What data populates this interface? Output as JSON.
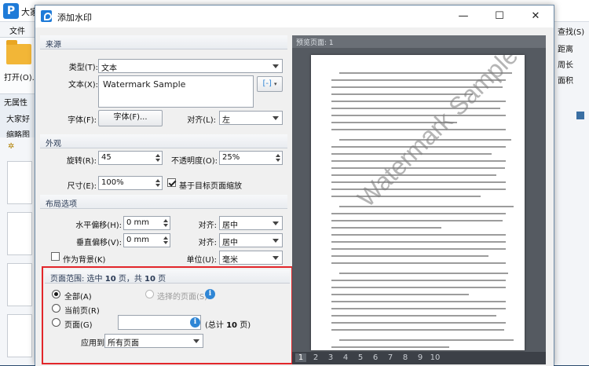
{
  "bg": {
    "app_title": "大家",
    "menu_file": "文件",
    "open_label": "打开(O)...",
    "no_props": "无属性",
    "doc_tab": "大家好",
    "thumbs_tab": "缩略图",
    "right_items": [
      "查找(S)",
      "距离",
      "周长",
      "面积"
    ]
  },
  "dialog": {
    "title": "添加水印",
    "source": {
      "header": "来源",
      "type_label": "类型(T):",
      "type_value": "文本",
      "text_label": "文本(X):",
      "text_value": "Watermark Sample",
      "font_label": "字体(F):",
      "font_button": "字体(F)...",
      "align_label": "对齐(L):",
      "align_value": "左"
    },
    "appearance": {
      "header": "外观",
      "rotation_label": "旋转(R):",
      "rotation_value": "45",
      "opacity_label": "不透明度(O):",
      "opacity_value": "25%",
      "size_label": "尺寸(E):",
      "size_value": "100%",
      "relative_scale_label": "基于目标页面缩放",
      "relative_scale_checked": true
    },
    "layout": {
      "header": "布局选项",
      "h_offset_label": "水平偏移(H):",
      "h_offset_value": "0 mm",
      "h_align_label": "对齐:",
      "h_align_value": "居中",
      "v_offset_label": "垂直偏移(V):",
      "v_offset_value": "0 mm",
      "v_align_label": "对齐:",
      "v_align_value": "居中",
      "background_label": "作为背景(K)",
      "background_checked": false,
      "unit_label": "单位(U):",
      "unit_value": "毫米"
    },
    "page_range": {
      "summary_prefix": "页面范围: 选中 ",
      "selected_count": "10",
      "summary_mid": " 页，共 ",
      "total_count": "10",
      "summary_suffix": " 页",
      "all_label": "全部(A)",
      "selected_pages_label": "选择的页面(S)",
      "current_label": "当前页(R)",
      "pages_label": "页面(G)",
      "pages_value": "",
      "total_prefix": "(总计 ",
      "total_suffix": " 页)",
      "apply_label": "应用到:",
      "apply_value": "所有页面"
    },
    "preview": {
      "header": "预览页面: 1",
      "watermark_text": "Watermark Sample",
      "pages": [
        "1",
        "2",
        "3",
        "4",
        "5",
        "6",
        "7",
        "8",
        "9",
        "10"
      ],
      "current_page": "1"
    }
  },
  "colors": {
    "highlight_border": "#e2262a",
    "info_icon": "#2f86d5"
  }
}
